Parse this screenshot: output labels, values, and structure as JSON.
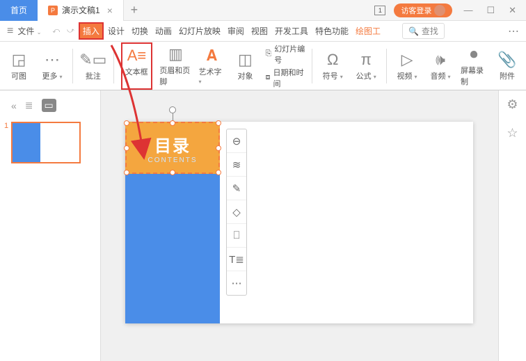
{
  "titlebar": {
    "home_tab": "首页",
    "doc_tab": "演示文稿1",
    "doc_icon": "P",
    "add": "+",
    "close": "×",
    "window_number": "1",
    "login": "访客登录"
  },
  "menubar": {
    "file": "文件",
    "items": [
      "插入",
      "设计",
      "切换",
      "动画",
      "幻灯片放映",
      "审阅",
      "视图",
      "开发工具",
      "特色功能",
      "绘图工"
    ],
    "search": "查找"
  },
  "ribbon": {
    "view": "可图",
    "more": "更多",
    "comment": "批注",
    "textbox": "文本框",
    "header_footer": "页眉和页脚",
    "wordart": "艺术字",
    "object": "对象",
    "slide_number": "幻灯片编号",
    "datetime": "日期和时间",
    "symbol": "符号",
    "formula": "公式",
    "video": "视频",
    "audio": "音频",
    "record": "屏幕录制",
    "attach": "附件"
  },
  "slide_panel": {
    "number": "1"
  },
  "slide_content": {
    "title": "目录",
    "subtitle": "CONTENTS"
  }
}
